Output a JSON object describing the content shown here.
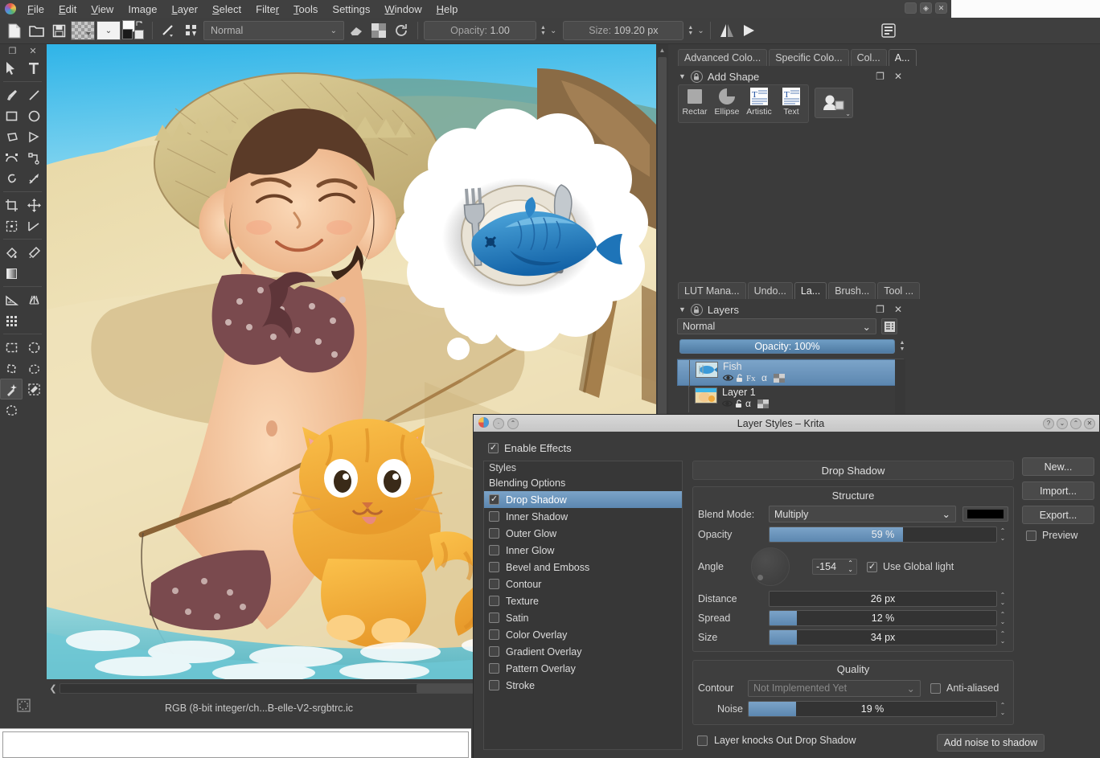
{
  "menubar": {
    "logo_icon": "krita-logo-icon",
    "items": [
      "File",
      "Edit",
      "View",
      "Image",
      "Layer",
      "Select",
      "Filter",
      "Tools",
      "Settings",
      "Window",
      "Help"
    ],
    "window_controls": [
      "minimize",
      "restore",
      "close"
    ]
  },
  "toolbar": {
    "new_icon": "new-document-icon",
    "open_icon": "open-folder-icon",
    "save_icon": "save-floppy-icon",
    "pattern_icon": "checker-pattern-swatch",
    "gradient_icon": "gradient-swatch",
    "gradient_chevron": "chevron-down-icon",
    "fgbg_icon": "foreground-background-color-icon",
    "brush_preset_icon": "brush-preset-icon",
    "brush_chevron": "chevron-down-icon",
    "preset_selector_icon": "brush-preset-selector-icon",
    "blend_mode": "Normal",
    "blend_chevron": "chevron-down-icon",
    "eraser_icon": "eraser-icon",
    "alpha_icon": "preserve-alpha-icon",
    "reload_icon": "reload-preset-icon",
    "opacity_label": "Opacity:",
    "opacity_value": "1.00",
    "size_label": "Size:",
    "size_value": "109.20 px",
    "mirror_h_icon": "mirror-horizontal-icon",
    "mirror_v_icon": "mirror-vertical-icon",
    "workspace_icon": "workspace-chooser-icon"
  },
  "toolbox": {
    "float_icon": "float-docker-icon",
    "close_icon": "close-icon",
    "tools": [
      {
        "name": "shape-select-tool",
        "icon": "cursor-arrow"
      },
      {
        "name": "text-tool",
        "icon": "letter-T"
      },
      {
        "name": "freehand-brush-tool",
        "icon": "paintbrush"
      },
      {
        "name": "line-tool",
        "icon": "diagonal-line"
      },
      {
        "name": "rectangle-tool",
        "icon": "square"
      },
      {
        "name": "ellipse-tool",
        "icon": "circle"
      },
      {
        "name": "polygon-tool",
        "icon": "polygon"
      },
      {
        "name": "polyline-tool",
        "icon": "polyline"
      },
      {
        "name": "bezier-curve-tool",
        "icon": "bezier-curve"
      },
      {
        "name": "freehand-path-tool",
        "icon": "path-node"
      },
      {
        "name": "dynamic-brush-tool",
        "icon": "dynamic-swirl"
      },
      {
        "name": "multibrush-tool",
        "icon": "multibrush-arrow"
      },
      {
        "name": "crop-tool",
        "icon": "crop"
      },
      {
        "name": "move-tool",
        "icon": "four-way-arrows"
      },
      {
        "name": "transform-tool",
        "icon": "transform-box"
      },
      {
        "name": "measure-tool",
        "icon": "measure-angle"
      },
      {
        "name": "fill-tool",
        "icon": "paint-bucket"
      },
      {
        "name": "color-picker-tool",
        "icon": "eyedropper"
      },
      {
        "name": "gradient-tool",
        "icon": "gradient-square"
      },
      {
        "name": "assistant-tool",
        "icon": "ruler-triangle"
      },
      {
        "name": "perspective-grid-tool",
        "icon": "perspective-grid"
      },
      {
        "name": "grid-tool",
        "icon": "grid-dots"
      },
      {
        "name": "rectangular-select-tool",
        "icon": "dashed-rect"
      },
      {
        "name": "elliptical-select-tool",
        "icon": "dashed-circle"
      },
      {
        "name": "polygonal-select-tool",
        "icon": "dashed-polygon"
      },
      {
        "name": "freehand-select-tool",
        "icon": "dashed-lasso"
      },
      {
        "name": "magic-wand-select-tool",
        "icon": "magic-wand",
        "selected": true
      },
      {
        "name": "similar-color-select-tool",
        "icon": "dashed-wand"
      },
      {
        "name": "bezier-select-tool",
        "icon": "dashed-bezier"
      }
    ]
  },
  "canvas": {
    "artwork_description": "Beach illustration: woman sunbathing in straw hat with orange tabby cat, thought bubble containing fish on a plate",
    "vscroll_up_icon": "chevron-up-icon",
    "hscroll_left_icon": "chevron-left-icon",
    "status_text": "RGB (8-bit integer/ch...B-elle-V2-srgbtrc.ic",
    "selection_icon": "selection-status-icon"
  },
  "right_dockers": {
    "top_tabs": [
      {
        "label": "Advanced Colo...",
        "active": false
      },
      {
        "label": "Specific Colo...",
        "active": false
      },
      {
        "label": "Col...",
        "active": false
      },
      {
        "label": "A...",
        "active": true
      }
    ],
    "add_shape": {
      "title": "Add Shape",
      "collapse_icon": "triangle-down-icon",
      "lock_icon": "lock-icon",
      "float_icon": "float-docker-icon",
      "close_icon": "close-icon",
      "shapes": [
        {
          "label": "Rectar",
          "icon": "rectangle-shape-icon"
        },
        {
          "label": "Ellipse",
          "icon": "ellipse-shape-icon"
        },
        {
          "label": "Artistic",
          "icon": "artistic-text-icon"
        },
        {
          "label": "Text",
          "icon": "text-shape-icon"
        }
      ],
      "extra_button_icon": "shape-group-icon",
      "extra_button_chevron": "chevron-down-icon"
    },
    "bottom_tabs": [
      {
        "label": "LUT Mana...",
        "active": false
      },
      {
        "label": "Undo...",
        "active": false
      },
      {
        "label": "La...",
        "active": true
      },
      {
        "label": "Brush...",
        "active": false
      },
      {
        "label": "Tool ...",
        "active": false
      }
    ],
    "layers": {
      "title": "Layers",
      "collapse_icon": "triangle-down-icon",
      "lock_icon": "lock-icon",
      "float_icon": "float-docker-icon",
      "close_icon": "close-icon",
      "blend_mode": "Normal",
      "blend_chevron": "chevron-down-icon",
      "properties_icon": "layer-properties-icon",
      "opacity_label": "Opacity:",
      "opacity_value": "100%",
      "rows": [
        {
          "name": "Fish",
          "selected": true,
          "icons": [
            "visible-eye-icon",
            "unlocked-icon",
            "fx-icon",
            "alpha-icon",
            "alpha-lock-icon"
          ]
        },
        {
          "name": "Layer 1",
          "selected": false,
          "icons": [
            "visible-eye-icon",
            "unlocked-icon",
            "alpha-icon",
            "alpha-lock-icon"
          ]
        }
      ]
    }
  },
  "dialog": {
    "title": "Layer Styles – Krita",
    "titlebar_left_icons": [
      "krita-logo-icon",
      "shade-icon",
      "keep-above-icon"
    ],
    "titlebar_right_icons": [
      "help-icon",
      "minimize-icon",
      "maximize-icon",
      "close-icon"
    ],
    "enable_effects_label": "Enable Effects",
    "enable_effects_checked": true,
    "styles_header": "Styles",
    "styles": [
      {
        "label": "Blending Options",
        "type": "header",
        "checked": false,
        "selected": false
      },
      {
        "label": "Drop Shadow",
        "type": "item",
        "checked": true,
        "selected": true
      },
      {
        "label": "Inner Shadow",
        "type": "item",
        "checked": false,
        "selected": false
      },
      {
        "label": "Outer Glow",
        "type": "item",
        "checked": false,
        "selected": false
      },
      {
        "label": "Inner Glow",
        "type": "item",
        "checked": false,
        "selected": false
      },
      {
        "label": "Bevel and Emboss",
        "type": "item",
        "checked": false,
        "selected": false
      },
      {
        "label": "Contour",
        "type": "item",
        "checked": false,
        "selected": false
      },
      {
        "label": "Texture",
        "type": "item",
        "checked": false,
        "selected": false
      },
      {
        "label": "Satin",
        "type": "item",
        "checked": false,
        "selected": false
      },
      {
        "label": "Color Overlay",
        "type": "item",
        "checked": false,
        "selected": false
      },
      {
        "label": "Gradient Overlay",
        "type": "item",
        "checked": false,
        "selected": false
      },
      {
        "label": "Pattern Overlay",
        "type": "item",
        "checked": false,
        "selected": false
      },
      {
        "label": "Stroke",
        "type": "item",
        "checked": false,
        "selected": false
      }
    ],
    "page_title": "Drop Shadow",
    "structure": {
      "title": "Structure",
      "blend_mode_label": "Blend Mode:",
      "blend_mode_value": "Multiply",
      "blend_chevron": "chevron-down-icon",
      "color_swatch": "#000000",
      "opacity_label": "Opacity",
      "opacity_value": "59 %",
      "opacity_pct": 59,
      "angle_label": "Angle",
      "angle_value": "-154",
      "angle_dial_icon": "angle-dial",
      "use_global_light_label": "Use Global light",
      "use_global_light_checked": true,
      "distance_label": "Distance",
      "distance_value": "26 px",
      "distance_pct": 0,
      "spread_label": "Spread",
      "spread_value": "12 %",
      "spread_pct": 12,
      "size_label": "Size",
      "size_value": "34 px",
      "size_pct": 12
    },
    "quality": {
      "title": "Quality",
      "contour_label": "Contour",
      "contour_value": "Not Implemented Yet",
      "contour_chevron": "chevron-down-icon",
      "antialiased_label": "Anti-aliased",
      "antialiased_checked": false,
      "noise_label": "Noise",
      "noise_value": "19 %",
      "noise_pct": 19,
      "knockout_label": "Layer knocks Out Drop Shadow",
      "knockout_checked": false
    },
    "buttons": {
      "new": "New...",
      "import": "Import...",
      "export": "Export...",
      "preview_label": "Preview",
      "preview_checked": false
    },
    "tooltip": "Add noise to shadow"
  },
  "colors": {
    "accent": "#5c87b0",
    "panel_bg": "#3b3b3b",
    "toolbar_bg": "#404040"
  }
}
